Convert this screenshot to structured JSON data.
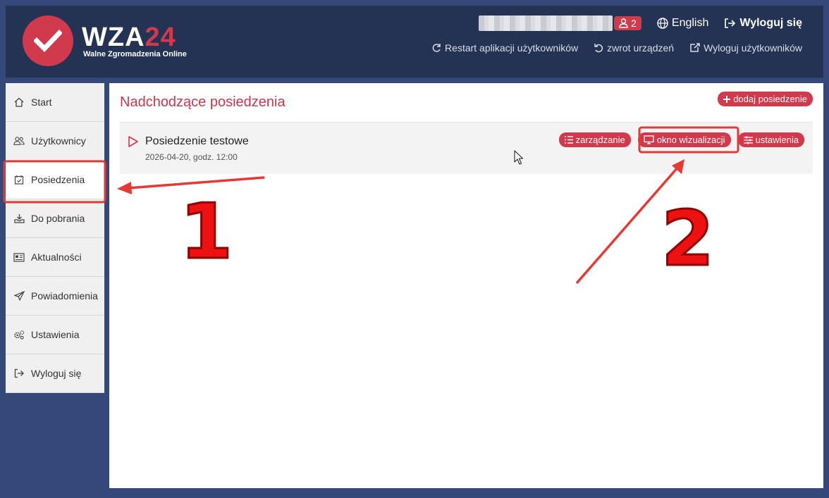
{
  "header": {
    "logo_main": "WZA",
    "logo_num": "24",
    "logo_sub": "Walne Zgromadzenia Online",
    "users_count": "2",
    "language": "English",
    "logout": "Wyloguj się",
    "restart_apps": "Restart aplikacji użytkowników",
    "return_devices": "zwrot urządzeń",
    "logout_users": "Wyloguj użytkowników"
  },
  "sidebar": {
    "items": [
      {
        "label": "Start",
        "icon": "home-icon"
      },
      {
        "label": "Użytkownicy",
        "icon": "users-icon"
      },
      {
        "label": "Posiedzenia",
        "icon": "calendar-check-icon"
      },
      {
        "label": "Do pobrania",
        "icon": "download-tray-icon"
      },
      {
        "label": "Aktualności",
        "icon": "newspaper-icon"
      },
      {
        "label": "Powiadomienia",
        "icon": "paper-plane-icon"
      },
      {
        "label": "Ustawienia",
        "icon": "gears-icon"
      },
      {
        "label": "Wyloguj się",
        "icon": "sign-out-icon"
      }
    ]
  },
  "main": {
    "title": "Nadchodzące posiedzenia",
    "add_button": "dodaj posiedzenie",
    "meeting": {
      "title": "Posiedzenie testowe",
      "date": "2026-04-20, godz. 12:00",
      "actions": {
        "manage": "zarządzanie",
        "visualization": "okno wizualizacji",
        "settings": "ustawienia"
      }
    }
  },
  "annotations": {
    "step1": "1",
    "step2": "2"
  },
  "colors": {
    "accent": "#d13a4c",
    "header_bg": "#243253",
    "page_bg": "#34497a",
    "annotation_red": "#e53935"
  }
}
